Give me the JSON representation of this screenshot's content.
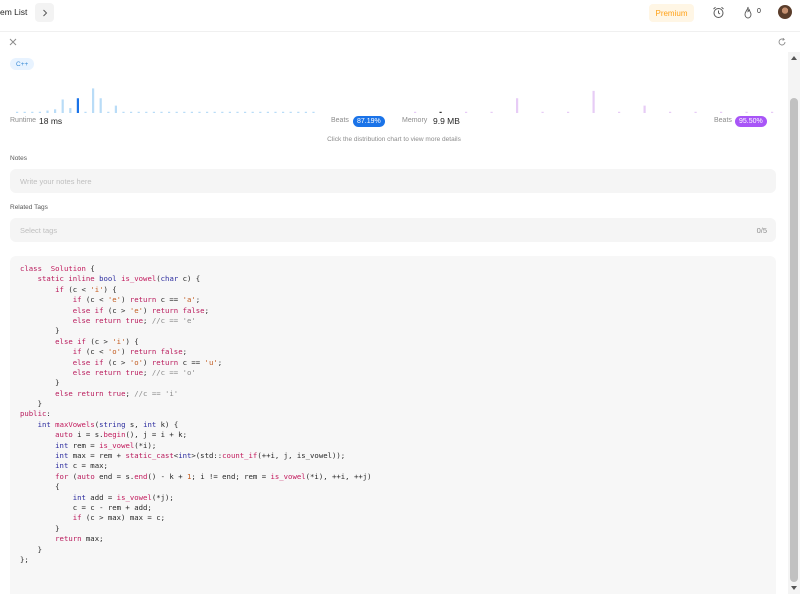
{
  "header": {
    "title": "em List",
    "premium_label": "Premium",
    "fire_count": "0"
  },
  "submission": {
    "language": "C++",
    "runtime_label": "Runtime",
    "runtime_value": "18 ms",
    "runtime_beats_label": "Beats",
    "runtime_beats": "87.19%",
    "memory_label": "Memory",
    "memory_value": "9.9 MB",
    "memory_beats_label": "Beats",
    "memory_beats": "95.50%",
    "hint": "Click the distribution chart to view more details"
  },
  "notes": {
    "label": "Notes",
    "placeholder": "Write your notes here"
  },
  "tags": {
    "label": "Related Tags",
    "placeholder": "Select tags",
    "count": "0/5"
  },
  "colors": {
    "accent_blue": "#1a73e8",
    "accent_purple": "#a855f7",
    "premium_orange": "#ffa116"
  },
  "chart_data": [
    {
      "type": "bar",
      "series": [
        {
          "values": [
            0.05,
            0.05,
            0.05,
            0.05,
            0.1,
            0.15,
            0.55,
            0.2,
            0.6,
            0.05,
            1.0,
            0.6,
            0.05,
            0.3,
            0.05,
            0.05,
            0.05,
            0.05,
            0.05,
            0.05,
            0.05,
            0.05,
            0.05,
            0.05,
            0.05,
            0.05,
            0.05,
            0.05,
            0.05,
            0.05,
            0.05,
            0.05,
            0.05,
            0.05,
            0.05,
            0.05,
            0.05,
            0.05,
            0.05,
            0.05
          ]
        }
      ],
      "highlight_index": 8
    },
    {
      "type": "bar",
      "series": [
        {
          "values": [
            0.05,
            0.05,
            0.05,
            0.05,
            0.6,
            0.05,
            0.05,
            0.9,
            0.05,
            0.3,
            0.05,
            0.05,
            0.05,
            0.05,
            0.05,
            0.05,
            0.05,
            0.05
          ]
        }
      ],
      "highlight_index": 1
    }
  ],
  "code_lines": [
    [
      [
        "kw",
        "class"
      ],
      [
        "",
        "  "
      ],
      [
        "fn",
        "Solution"
      ],
      [
        "",
        " {"
      ]
    ],
    [
      [
        "",
        "    "
      ],
      [
        "kw",
        "static"
      ],
      [
        "",
        " "
      ],
      [
        "kw",
        "inline"
      ],
      [
        "",
        " "
      ],
      [
        "tp",
        "bool"
      ],
      [
        "",
        " "
      ],
      [
        "fn",
        "is_vowel"
      ],
      [
        "",
        "("
      ],
      [
        "tp",
        "char"
      ],
      [
        "",
        " c) {"
      ]
    ],
    [
      [
        "",
        "        "
      ],
      [
        "kw",
        "if"
      ],
      [
        "",
        " (c < "
      ],
      [
        "st",
        "'i'"
      ],
      [
        "",
        ") {"
      ]
    ],
    [
      [
        "",
        "            "
      ],
      [
        "kw",
        "if"
      ],
      [
        "",
        " (c < "
      ],
      [
        "st",
        "'e'"
      ],
      [
        "",
        ") "
      ],
      [
        "kw",
        "return"
      ],
      [
        "",
        " c == "
      ],
      [
        "st",
        "'a'"
      ],
      [
        "",
        ";"
      ]
    ],
    [
      [
        "",
        "            "
      ],
      [
        "kw",
        "else if"
      ],
      [
        "",
        " (c > "
      ],
      [
        "st",
        "'e'"
      ],
      [
        "",
        ") "
      ],
      [
        "kw",
        "return"
      ],
      [
        "",
        " "
      ],
      [
        "kw",
        "false"
      ],
      [
        "",
        ";"
      ]
    ],
    [
      [
        "",
        "            "
      ],
      [
        "kw",
        "else return"
      ],
      [
        "",
        " "
      ],
      [
        "kw",
        "true"
      ],
      [
        "",
        "; "
      ],
      [
        "cm",
        "//c == 'e'"
      ]
    ],
    [
      [
        "",
        "        }"
      ]
    ],
    [
      [
        "",
        "        "
      ],
      [
        "kw",
        "else if"
      ],
      [
        "",
        " (c > "
      ],
      [
        "st",
        "'i'"
      ],
      [
        "",
        ") {"
      ]
    ],
    [
      [
        "",
        "            "
      ],
      [
        "kw",
        "if"
      ],
      [
        "",
        " (c < "
      ],
      [
        "st",
        "'o'"
      ],
      [
        "",
        ") "
      ],
      [
        "kw",
        "return"
      ],
      [
        "",
        " "
      ],
      [
        "kw",
        "false"
      ],
      [
        "",
        ";"
      ]
    ],
    [
      [
        "",
        "            "
      ],
      [
        "kw",
        "else if"
      ],
      [
        "",
        " (c > "
      ],
      [
        "st",
        "'o'"
      ],
      [
        "",
        ") "
      ],
      [
        "kw",
        "return"
      ],
      [
        "",
        " c == "
      ],
      [
        "st",
        "'u'"
      ],
      [
        "",
        ";"
      ]
    ],
    [
      [
        "",
        "            "
      ],
      [
        "kw",
        "else return"
      ],
      [
        "",
        " "
      ],
      [
        "kw",
        "true"
      ],
      [
        "",
        "; "
      ],
      [
        "cm",
        "//c == 'o'"
      ]
    ],
    [
      [
        "",
        "        }"
      ]
    ],
    [
      [
        "",
        "        "
      ],
      [
        "kw",
        "else return"
      ],
      [
        "",
        " "
      ],
      [
        "kw",
        "true"
      ],
      [
        "",
        "; "
      ],
      [
        "cm",
        "//c == 'i'"
      ]
    ],
    [
      [
        "",
        "    }"
      ]
    ],
    [
      [
        "kw",
        "public"
      ],
      [
        "",
        ":"
      ]
    ],
    [
      [
        "",
        "    "
      ],
      [
        "tp",
        "int"
      ],
      [
        "",
        " "
      ],
      [
        "fn",
        "maxVowels"
      ],
      [
        "",
        "("
      ],
      [
        "tp",
        "string"
      ],
      [
        "",
        " s, "
      ],
      [
        "tp",
        "int"
      ],
      [
        "",
        " k) {"
      ]
    ],
    [
      [
        "",
        "        "
      ],
      [
        "kw",
        "auto"
      ],
      [
        "",
        " i = s."
      ],
      [
        "fn",
        "begin"
      ],
      [
        "",
        "(), j = i + k;"
      ]
    ],
    [
      [
        "",
        "        "
      ],
      [
        "tp",
        "int"
      ],
      [
        "",
        " rem = "
      ],
      [
        "fn",
        "is_vowel"
      ],
      [
        "",
        "(*i);"
      ]
    ],
    [
      [
        "",
        "        "
      ],
      [
        "tp",
        "int"
      ],
      [
        "",
        " max = rem + "
      ],
      [
        "kw",
        "static_cast"
      ],
      [
        "",
        "<"
      ],
      [
        "tp",
        "int"
      ],
      [
        "",
        ">(std::"
      ],
      [
        "fn",
        "count_if"
      ],
      [
        "",
        "(++i, j, is_vowel));"
      ]
    ],
    [
      [
        "",
        "        "
      ],
      [
        "tp",
        "int"
      ],
      [
        "",
        " c = max;"
      ]
    ],
    [
      [
        "",
        "        "
      ],
      [
        "kw",
        "for"
      ],
      [
        "",
        " ("
      ],
      [
        "kw",
        "auto"
      ],
      [
        "",
        " end = s."
      ],
      [
        "fn",
        "end"
      ],
      [
        "",
        "() - k + "
      ],
      [
        "st",
        "1"
      ],
      [
        "",
        "; i != end; rem = "
      ],
      [
        "fn",
        "is_vowel"
      ],
      [
        "",
        "(*i), ++i, ++j)"
      ]
    ],
    [
      [
        "",
        "        {"
      ]
    ],
    [
      [
        "",
        "            "
      ],
      [
        "tp",
        "int"
      ],
      [
        "",
        " add = "
      ],
      [
        "fn",
        "is_vowel"
      ],
      [
        "",
        "(*j);"
      ]
    ],
    [
      [
        "",
        "            c = c - rem + add;"
      ]
    ],
    [
      [
        "",
        "            "
      ],
      [
        "kw",
        "if"
      ],
      [
        "",
        " (c > max) max = c;"
      ]
    ],
    [
      [
        "",
        "        }"
      ]
    ],
    [
      [
        "",
        "        "
      ],
      [
        "kw",
        "return"
      ],
      [
        "",
        " max;"
      ]
    ],
    [
      [
        "",
        "    }"
      ]
    ],
    [
      [
        "",
        "};"
      ]
    ]
  ]
}
